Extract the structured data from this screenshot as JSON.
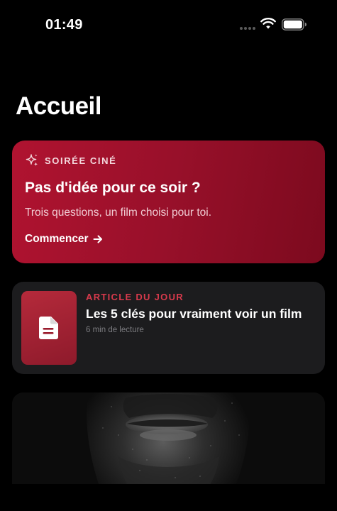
{
  "status_bar": {
    "time": "01:49",
    "icons": [
      "signal-dots-icon",
      "wifi-icon",
      "battery-icon"
    ]
  },
  "page": {
    "title": "Accueil"
  },
  "hero": {
    "eyebrow": "SOIRÉE CINÉ",
    "title": "Pas d'idée pour ce soir ?",
    "subtitle": "Trois questions, un film choisi pour toi.",
    "cta_label": "Commencer",
    "icon": "sparkles-icon",
    "cta_icon": "arrow-right-icon",
    "color": "#a5112b"
  },
  "article": {
    "eyebrow": "ARTICLE DU JOUR",
    "title": "Les 5 clés pour vraiment voir un film",
    "meta": "6 min de lecture",
    "icon": "document-icon",
    "accent_color": "#d83a4c"
  },
  "feature_image": {
    "icon": "portrait-image"
  },
  "colors": {
    "background": "#000000",
    "card": "#1c1c1e",
    "accent": "#b01330"
  }
}
